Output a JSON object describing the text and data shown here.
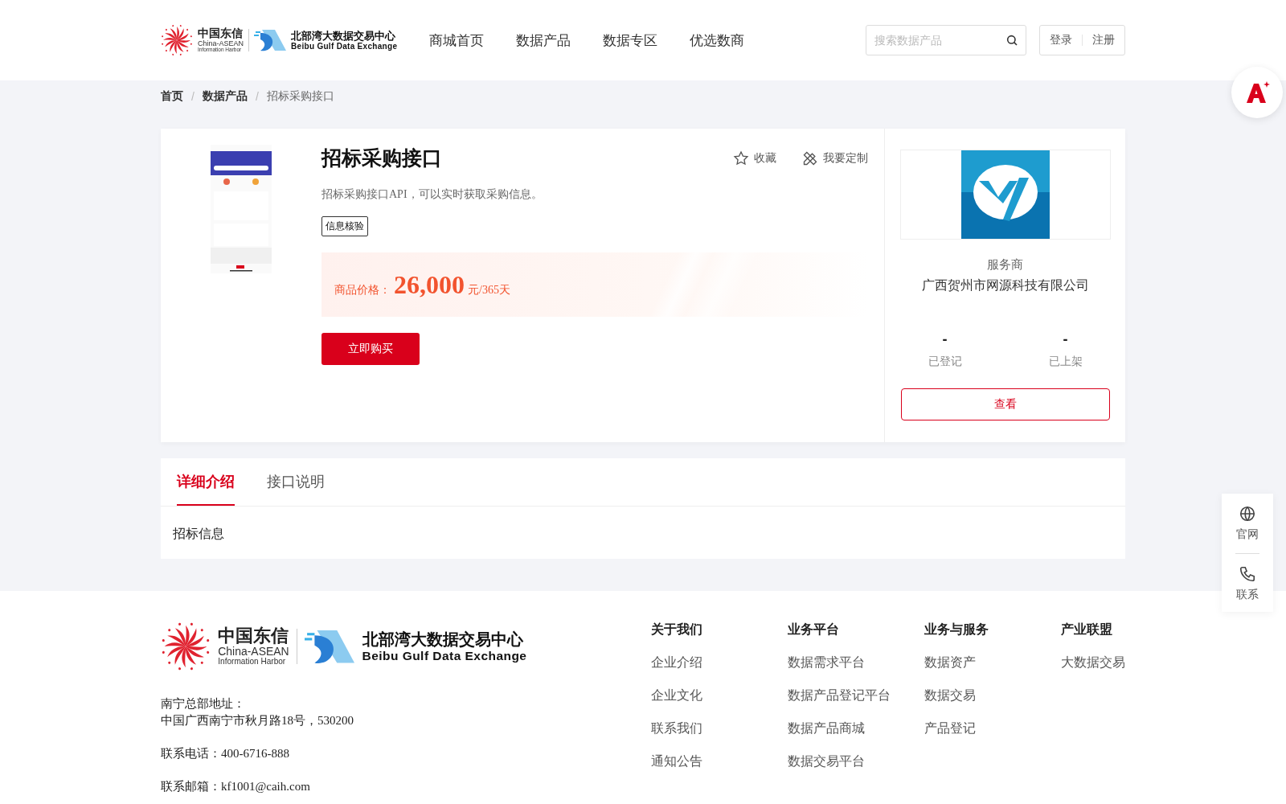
{
  "header": {
    "logo": {
      "brand_cn": "中国东信",
      "brand_en_1": "China-ASEAN",
      "brand_en_2": "Information Harbor",
      "exchange_cn": "北部湾大数据交易中心",
      "exchange_en": "Beibu Gulf Data Exchange"
    },
    "nav": [
      {
        "label": "商城首页",
        "selected": false
      },
      {
        "label": "数据产品",
        "selected": false
      },
      {
        "label": "数据专区",
        "selected": false
      },
      {
        "label": "优选数商",
        "selected": false
      }
    ],
    "search": {
      "placeholder": "搜索数据产品"
    },
    "auth": [
      "登录",
      "注册"
    ]
  },
  "breadcrumb_separator": "/",
  "breadcrumb": [
    {
      "label": "首页",
      "selected": false
    },
    {
      "label": "数据产品",
      "selected": false
    },
    {
      "label": "招标采购接口",
      "selected": true
    }
  ],
  "product": {
    "title": "招标采购接口",
    "description": "招标采购接口API，可以实时获取采购信息。",
    "tags": [
      "信息核验"
    ],
    "actions": [
      {
        "kind": "favorite",
        "label": "收藏"
      },
      {
        "kind": "customize",
        "label": "我要定制"
      }
    ],
    "price": {
      "label": "商品价格：",
      "amount": "26,000",
      "unit": "元/365天"
    },
    "buy_button": "立即购买"
  },
  "provider": {
    "role": "服务商",
    "name": "广西贺州市网源科技有限公司",
    "stats": [
      {
        "value": "-",
        "label": "已登记"
      },
      {
        "value": "-",
        "label": "已上架"
      }
    ],
    "button": "查看"
  },
  "tabs": [
    {
      "label": "详细介绍",
      "selected": true
    },
    {
      "label": "接口说明",
      "selected": false
    }
  ],
  "tab_content": "招标信息",
  "footer": {
    "logo": {
      "brand_cn": "中国东信",
      "brand_en_1": "China-ASEAN",
      "brand_en_2": "Information Harbor",
      "exchange_cn": "北部湾大数据交易中心",
      "exchange_en": "Beibu Gulf Data Exchange"
    },
    "address_label": "南宁总部地址：",
    "address": "中国广西南宁市秋月路18号，530200",
    "phone": "联系电话：400-6716-888",
    "email": "联系邮箱：kf1001@caih.com",
    "columns": [
      {
        "title": "关于我们",
        "links": [
          "企业介绍",
          "企业文化",
          "联系我们",
          "通知公告"
        ]
      },
      {
        "title": "业务平台",
        "links": [
          "数据需求平台",
          "数据产品登记平台",
          "数据产品商城",
          "数据交易平台"
        ]
      },
      {
        "title": "业务与服务",
        "links": [
          "数据资产",
          "数据交易",
          "产品登记"
        ]
      },
      {
        "title": "产业联盟",
        "links": [
          "大数据交易"
        ]
      }
    ]
  },
  "side_panel": [
    {
      "kind": "website",
      "label": "官网"
    },
    {
      "kind": "contact",
      "label": "联系"
    }
  ]
}
